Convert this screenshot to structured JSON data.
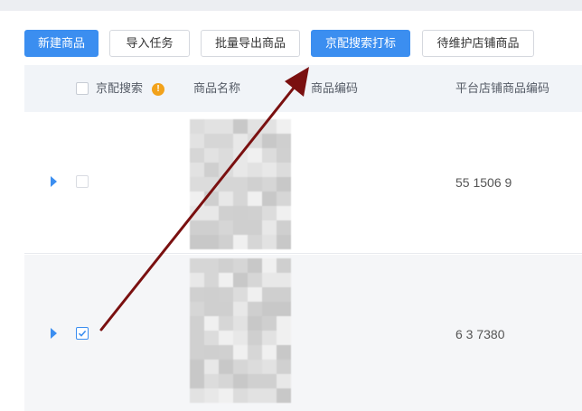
{
  "toolbar": {
    "new_product": "新建商品",
    "import_task": "导入任务",
    "bulk_export": "批量导出商品",
    "jd_search_tag": "京配搜索打标",
    "pending_store_products": "待维护店铺商品"
  },
  "table": {
    "columns": {
      "jd_search": "京配搜索",
      "info_badge": "!",
      "product_name": "商品名称",
      "product_code": "商品编码",
      "platform_store_code": "平台店铺商品编码"
    },
    "rows": [
      {
        "checked": false,
        "platform_store_code": "55     1506  9"
      },
      {
        "checked": true,
        "platform_store_code": "6  3     7380"
      }
    ]
  },
  "colors": {
    "primary": "#3b8ef0",
    "arrow": "#7a1010",
    "info": "#f2a21b"
  }
}
